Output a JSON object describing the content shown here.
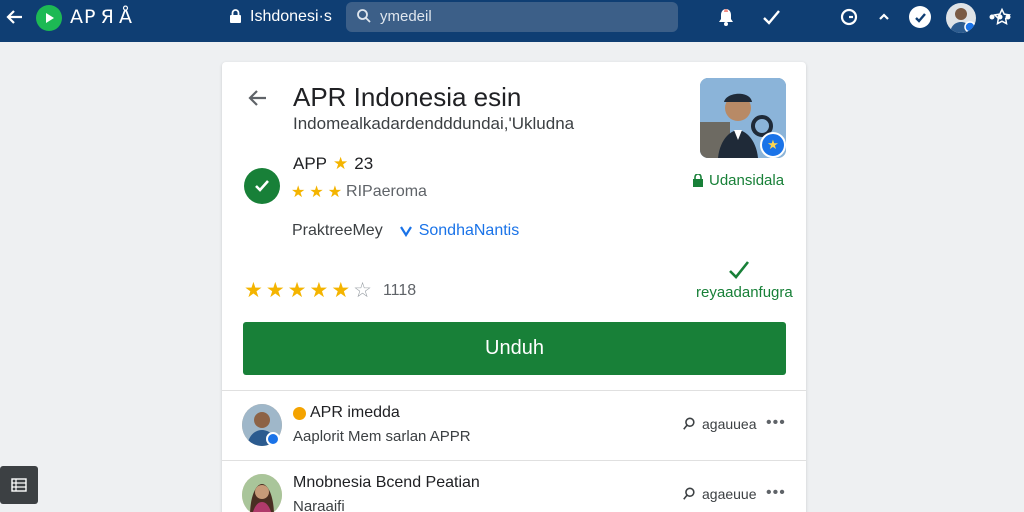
{
  "topbar": {
    "app_name": "AP Я Å",
    "site_text": "Ishdonesi·s",
    "search_value": "ymedeil"
  },
  "card": {
    "title": "APR Indonesia esin",
    "subtitle": "Indomealkadardendddundai,'Ukludna",
    "app_label": "APP",
    "app_score": "23",
    "sub_rating_text": "RIPaeroma",
    "right_tag_1": "Udansidala",
    "developer_label": "PraktreeMey",
    "developer_link": "SondhaNantis",
    "rating_count": "1118",
    "right_tag_2": "reyaadanfugra",
    "install_label": "Unduh"
  },
  "list": [
    {
      "title": "APR imedda",
      "subtitle": "Aaplorit Mem sarlan APPR",
      "action": "agauuea"
    },
    {
      "title": "Mnobnesia Bcend Peatian",
      "subtitle": "Naraaifi",
      "action": "agaeuue"
    }
  ],
  "colors": {
    "topbar": "#0f3e73",
    "accent_green": "#188038",
    "star_gold": "#f4b400",
    "link_blue": "#1a73e8"
  },
  "icons": [
    "back-arrow-icon",
    "play-logo-icon",
    "lock-icon",
    "search-icon",
    "star-icon",
    "notification-icon",
    "check-icon",
    "timer-icon",
    "chevron-up-icon",
    "account-icon",
    "avatar",
    "more-icon",
    "verified-check-icon",
    "list-icon"
  ]
}
